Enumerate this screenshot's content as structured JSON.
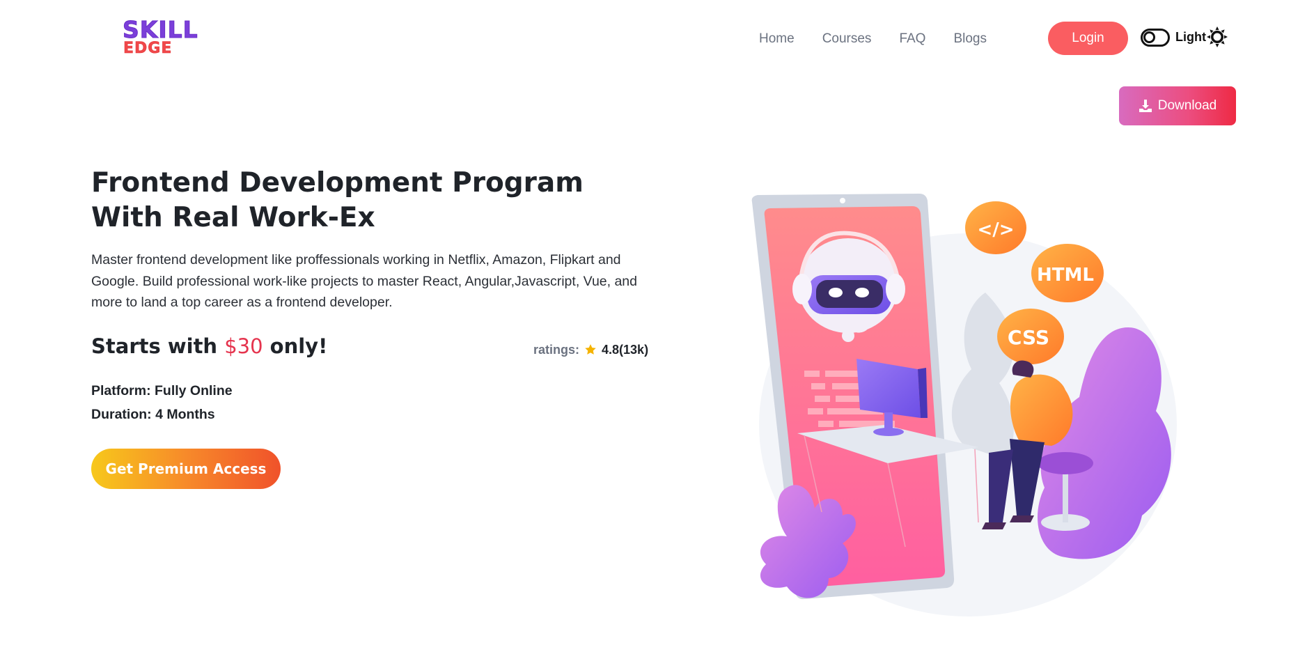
{
  "brand": {
    "line1": "SKILL",
    "line2": "EDGE"
  },
  "nav": {
    "items": [
      "Home",
      "Courses",
      "FAQ",
      "Blogs"
    ]
  },
  "header": {
    "login_label": "Login",
    "theme_label": "Light",
    "download_label": "Download"
  },
  "hero": {
    "title": "Frontend Development Program With Real Work-Ex",
    "description": "Master frontend development like proffessionals working in Netflix, Amazon, Flipkart and Google. Build professional work-like projects to master React, Angular,Javascript, Vue, and more to land a top career as a frontend developer.",
    "price_prefix": "Starts with",
    "price": "$30",
    "price_suffix": "only!",
    "ratings_label": "ratings:",
    "ratings_value": "4.8(13k)",
    "platform": "Platform: Fully Online",
    "duration": "Duration: 4 Months",
    "cta_label": "Get Premium Access"
  },
  "illustration": {
    "bubbles": [
      "</>",
      "HTML",
      "CSS"
    ]
  },
  "colors": {
    "brand_purple": "#7b3fd9",
    "brand_red": "#f0484a",
    "login": "#fa5d61",
    "price": "#e5344e",
    "star": "#f5b301"
  },
  "icons": [
    "sun-icon",
    "download-icon",
    "star-icon",
    "theme-toggle"
  ]
}
